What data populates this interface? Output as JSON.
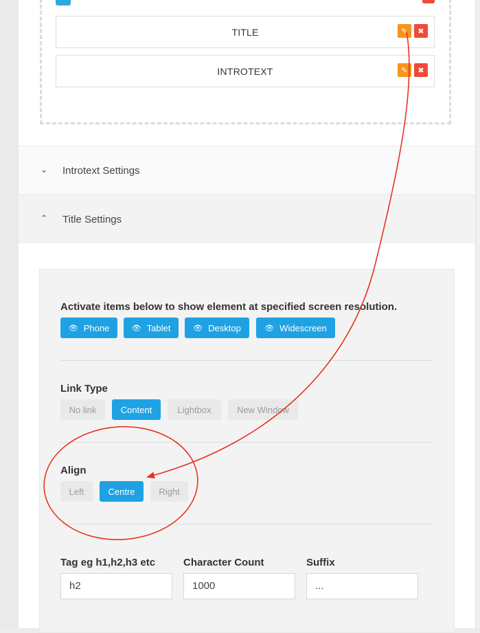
{
  "elements": [
    {
      "label": "TITLE"
    },
    {
      "label": "INTROTEXT"
    }
  ],
  "accordions": {
    "introtext": {
      "label": "Introtext Settings",
      "state": "collapsed"
    },
    "title": {
      "label": "Title Settings",
      "state": "expanded"
    }
  },
  "settings": {
    "visibility_heading": "Activate items below to show element at specified screen resolution.",
    "devices": [
      "Phone",
      "Tablet",
      "Desktop",
      "Widescreen"
    ],
    "link_type": {
      "heading": "Link Type",
      "options": [
        "No link",
        "Content",
        "Lightbox",
        "New Window"
      ],
      "selected": "Content"
    },
    "align": {
      "heading": "Align",
      "options": [
        "Left",
        "Centre",
        "Right"
      ],
      "selected": "Centre"
    },
    "fields": [
      {
        "label": "Tag eg h1,h2,h3 etc",
        "value": "h2"
      },
      {
        "label": "Character Count",
        "value": "1000"
      },
      {
        "label": "Suffix",
        "value": "..."
      }
    ]
  },
  "colors": {
    "accent_blue": "#1fa2e3",
    "edit_orange": "#f7941d",
    "delete_red": "#ee4b3a",
    "annotation_red": "#e8321f"
  }
}
